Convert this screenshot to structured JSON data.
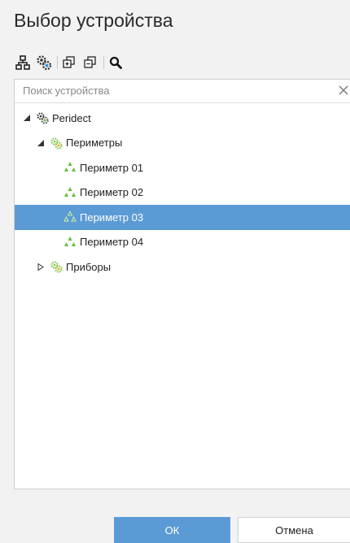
{
  "dialog": {
    "title": "Выбор устройства"
  },
  "toolbar": {
    "icons": [
      "tree-view-icon",
      "device-settings-icon",
      "expand-all-icon",
      "collapse-all-icon",
      "search-icon"
    ]
  },
  "search": {
    "placeholder": "Поиск устройства",
    "value": ""
  },
  "tree": {
    "root": {
      "label": "Peridect",
      "expanded": true,
      "icon": "gear-cluster-icon"
    },
    "perimeters": {
      "label": "Периметры",
      "expanded": true,
      "icon": "green-gears-icon",
      "items": [
        {
          "label": "Периметр 01",
          "selected": false
        },
        {
          "label": "Периметр 02",
          "selected": false
        },
        {
          "label": "Периметр 03",
          "selected": true
        },
        {
          "label": "Периметр 04",
          "selected": false
        }
      ]
    },
    "devices": {
      "label": "Приборы",
      "expanded": false,
      "icon": "green-gears-icon"
    }
  },
  "buttons": {
    "ok_label": "ОК",
    "cancel_label": "Отмена"
  },
  "colors": {
    "accent": "#5b9bd5",
    "perimeter_icon": "#5fbf3c",
    "gear_green": "#7cc242",
    "gear_blue": "#3d8ed8"
  }
}
